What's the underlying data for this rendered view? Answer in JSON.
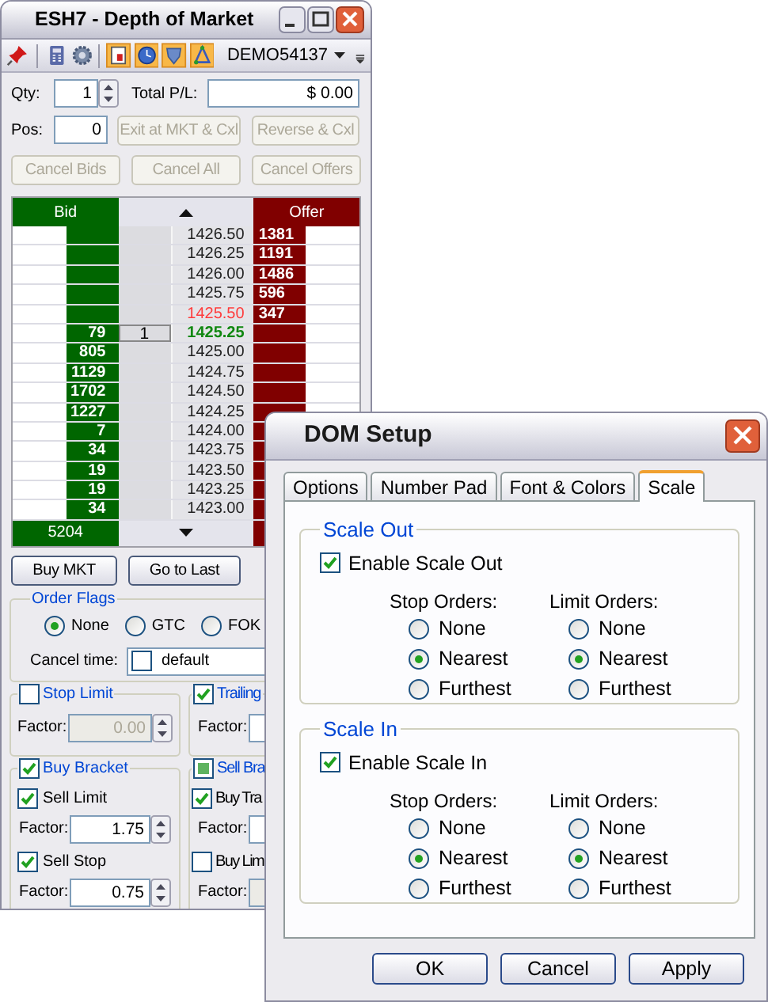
{
  "main_window": {
    "title": "ESH7 - Depth of Market",
    "account": "DEMO54137",
    "qty": {
      "label": "Qty:",
      "value": "1"
    },
    "total_pl": {
      "label": "Total P/L:",
      "value": "$ 0.00"
    },
    "pos": {
      "label": "Pos:",
      "value": "0"
    },
    "position_buttons": [
      {
        "label": "Exit at MKT & Cxl",
        "disabled": true
      },
      {
        "label": "Reverse & Cxl",
        "disabled": true
      }
    ],
    "cancel_buttons": [
      {
        "label": "Cancel Bids",
        "disabled": true
      },
      {
        "label": "Cancel All",
        "disabled": true
      },
      {
        "label": "Cancel Offers",
        "disabled": true
      }
    ],
    "ladder": {
      "bid_header": "Bid",
      "offer_header": "Offer",
      "bid_total": "5204",
      "rows": [
        {
          "price": "1426.50",
          "offer": "1381",
          "kind": "normal"
        },
        {
          "price": "1426.25",
          "offer": "1191",
          "kind": "normal"
        },
        {
          "price": "1426.00",
          "offer": "1486",
          "kind": "normal"
        },
        {
          "price": "1425.75",
          "offer": "596",
          "kind": "normal"
        },
        {
          "price": "1425.50",
          "offer": "347",
          "kind": "ask"
        },
        {
          "price": "1425.25",
          "bid": "79",
          "order": "1",
          "kind": "last"
        },
        {
          "price": "1425.00",
          "bid": "805",
          "kind": "normal"
        },
        {
          "price": "1424.75",
          "bid": "1129",
          "kind": "normal"
        },
        {
          "price": "1424.50",
          "bid": "1702",
          "kind": "normal"
        },
        {
          "price": "1424.25",
          "bid": "1227",
          "kind": "normal"
        },
        {
          "price": "1424.00",
          "bid": "7",
          "kind": "normal"
        },
        {
          "price": "1423.75",
          "bid": "34",
          "kind": "normal"
        },
        {
          "price": "1423.50",
          "bid": "19",
          "kind": "normal"
        },
        {
          "price": "1423.25",
          "bid": "19",
          "kind": "normal"
        },
        {
          "price": "1423.00",
          "bid": "34",
          "kind": "normal"
        }
      ]
    },
    "action_buttons": [
      {
        "label": "Buy MKT"
      },
      {
        "label": "Go to Last"
      }
    ],
    "order_flags": {
      "title": "Order Flags",
      "options": [
        {
          "label": "None",
          "selected": true
        },
        {
          "label": "GTC",
          "selected": false
        },
        {
          "label": "FOK",
          "selected": false
        }
      ],
      "cancel_time": {
        "label": "Cancel time:",
        "checked": false,
        "value": "default"
      }
    },
    "stop_limit": {
      "title": "Stop Limit",
      "checked": false,
      "factor_label": "Factor:",
      "factor": "0.00",
      "disabled": true
    },
    "trailing": {
      "title": "Trailing",
      "checked": true,
      "factor_label": "Factor:"
    },
    "buy_bracket": {
      "title": "Buy Bracket",
      "checked": true,
      "items": [
        {
          "label": "Sell Limit",
          "checked": true,
          "factor_label": "Factor:",
          "factor": "1.75"
        },
        {
          "label": "Sell Stop",
          "checked": true,
          "factor_label": "Factor:",
          "factor": "0.75"
        }
      ]
    },
    "sell_bracket": {
      "title": "Sell Bra",
      "indeterminate": true,
      "items": [
        {
          "label": "Buy Tra",
          "checked": true,
          "factor_label": "Factor:"
        },
        {
          "label": "Buy Lim",
          "checked": false,
          "factor_label": "Factor:"
        }
      ]
    }
  },
  "dialog": {
    "title": "DOM Setup",
    "tabs": [
      {
        "label": "Options",
        "selected": false
      },
      {
        "label": "Number Pad",
        "selected": false
      },
      {
        "label": "Font & Colors",
        "selected": false
      },
      {
        "label": "Scale",
        "selected": true
      }
    ],
    "groups": [
      {
        "title": "Scale Out",
        "enable": {
          "label": "Enable Scale Out",
          "checked": true
        },
        "columns": [
          {
            "title": "Stop Orders:",
            "options": [
              {
                "label": "None",
                "selected": false
              },
              {
                "label": "Nearest",
                "selected": true
              },
              {
                "label": "Furthest",
                "selected": false
              }
            ]
          },
          {
            "title": "Limit Orders:",
            "options": [
              {
                "label": "None",
                "selected": false
              },
              {
                "label": "Nearest",
                "selected": true
              },
              {
                "label": "Furthest",
                "selected": false
              }
            ]
          }
        ]
      },
      {
        "title": "Scale In",
        "enable": {
          "label": "Enable Scale In",
          "checked": true
        },
        "columns": [
          {
            "title": "Stop Orders:",
            "options": [
              {
                "label": "None",
                "selected": false
              },
              {
                "label": "Nearest",
                "selected": true
              },
              {
                "label": "Furthest",
                "selected": false
              }
            ]
          },
          {
            "title": "Limit Orders:",
            "options": [
              {
                "label": "None",
                "selected": false
              },
              {
                "label": "Nearest",
                "selected": true
              },
              {
                "label": "Furthest",
                "selected": false
              }
            ]
          }
        ]
      }
    ],
    "buttons": [
      {
        "label": "OK"
      },
      {
        "label": "Cancel"
      },
      {
        "label": "Apply"
      }
    ]
  }
}
